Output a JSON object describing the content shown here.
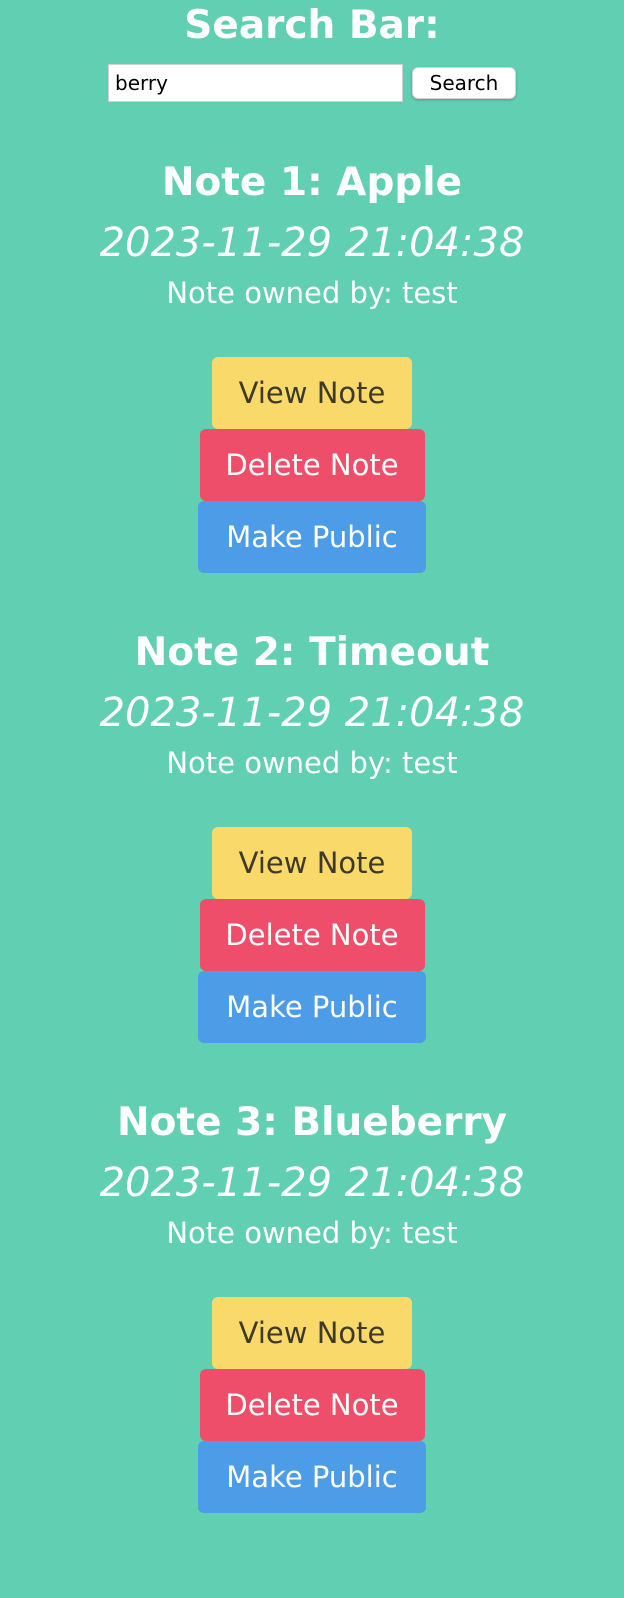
{
  "search": {
    "title": "Search Bar:",
    "value": "berry",
    "button_label": "Search"
  },
  "notes": [
    {
      "title": "Note 1: Apple",
      "date": "2023-11-29 21:04:38",
      "owner": "Note owned by: test",
      "view_label": "View Note",
      "delete_label": "Delete Note",
      "public_label": "Make Public"
    },
    {
      "title": "Note 2: Timeout",
      "date": "2023-11-29 21:04:38",
      "owner": "Note owned by: test",
      "view_label": "View Note",
      "delete_label": "Delete Note",
      "public_label": "Make Public"
    },
    {
      "title": "Note 3: Blueberry",
      "date": "2023-11-29 21:04:38",
      "owner": "Note owned by: test",
      "view_label": "View Note",
      "delete_label": "Delete Note",
      "public_label": "Make Public"
    }
  ],
  "colors": {
    "background": "#61cfb1",
    "view_button": "#f9d96a",
    "delete_button": "#ee4e6a",
    "public_button": "#4d9ce8"
  }
}
